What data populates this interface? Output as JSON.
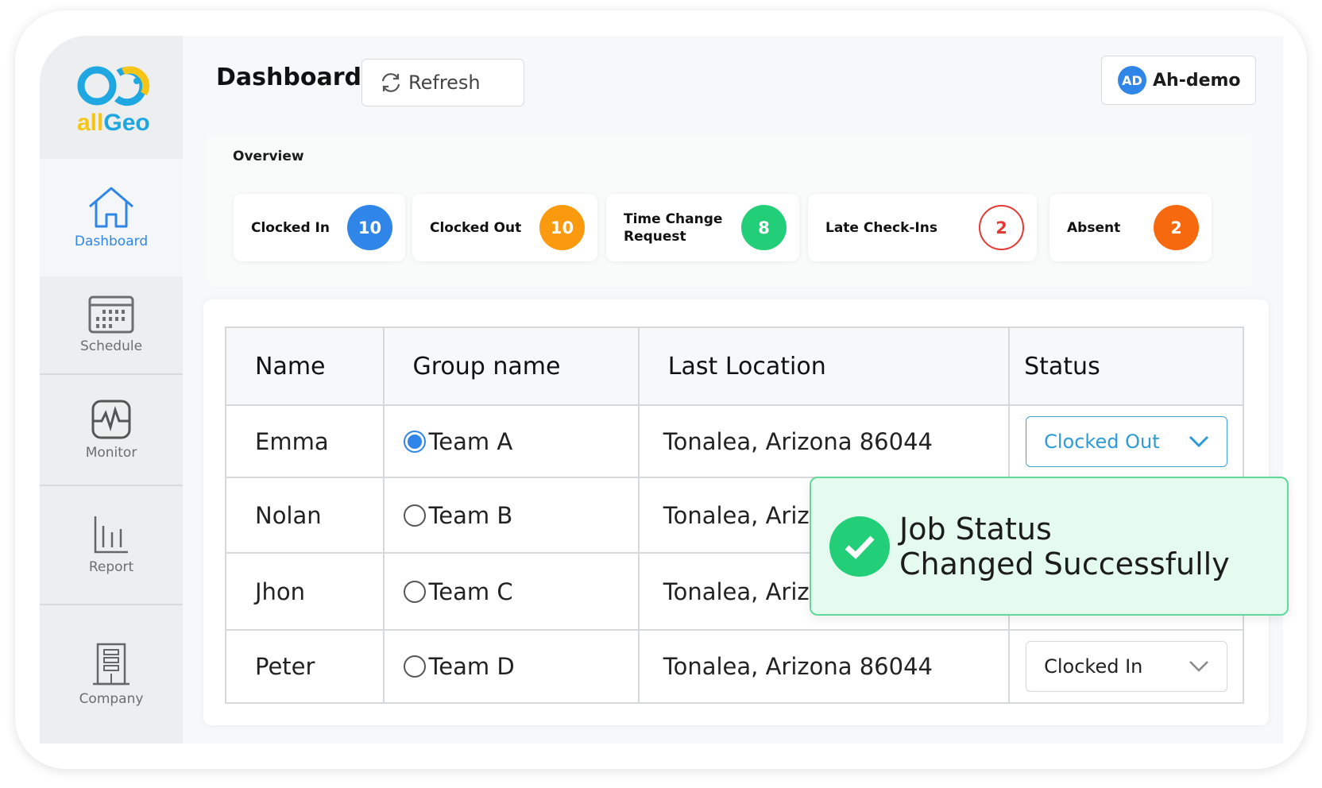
{
  "brand": {
    "logo_text": "allGeo"
  },
  "header": {
    "title": "Dashboard",
    "refresh_label": "Refresh",
    "user_initials": "AD",
    "user_name": "Ah-demo"
  },
  "sidebar": {
    "items": [
      {
        "label": "Dashboard",
        "icon": "home-icon",
        "active": true
      },
      {
        "label": "Schedule",
        "icon": "calendar-icon"
      },
      {
        "label": "Monitor",
        "icon": "monitor-pulse-icon"
      },
      {
        "label": "Report",
        "icon": "bar-chart-icon"
      },
      {
        "label": "Company",
        "icon": "building-icon"
      }
    ]
  },
  "overview": {
    "title": "Overview",
    "cards": [
      {
        "label": "Clocked In",
        "count": "10",
        "color": "#2f86e8"
      },
      {
        "label": "Clocked Out",
        "count": "10",
        "color": "#fb9a0e"
      },
      {
        "label": "Time Change Request",
        "count": "8",
        "color": "#22cf78"
      },
      {
        "label": "Late Check-Ins",
        "count": "2",
        "color": "#e53935"
      },
      {
        "label": "Absent",
        "count": "2",
        "color": "#f7690f"
      }
    ]
  },
  "table": {
    "headers": [
      "Name",
      "Group name",
      "Last Location",
      "Status"
    ],
    "rows": [
      {
        "name": "Emma",
        "group": "Team A",
        "selected": true,
        "location": "Tonalea, Arizona 86044",
        "status": "Clocked Out"
      },
      {
        "name": "Nolan",
        "group": "Team B",
        "selected": false,
        "location": "Tonalea, Ariz",
        "status": ""
      },
      {
        "name": "Jhon",
        "group": "Team C",
        "selected": false,
        "location": "Tonalea, Ariz",
        "status": ""
      },
      {
        "name": "Peter",
        "group": "Team D",
        "selected": false,
        "location": "Tonalea, Arizona 86044",
        "status": "Clocked In"
      }
    ]
  },
  "toast": {
    "line1": "Job Status",
    "line2": "Changed Successfully",
    "color": "#22cf78"
  }
}
